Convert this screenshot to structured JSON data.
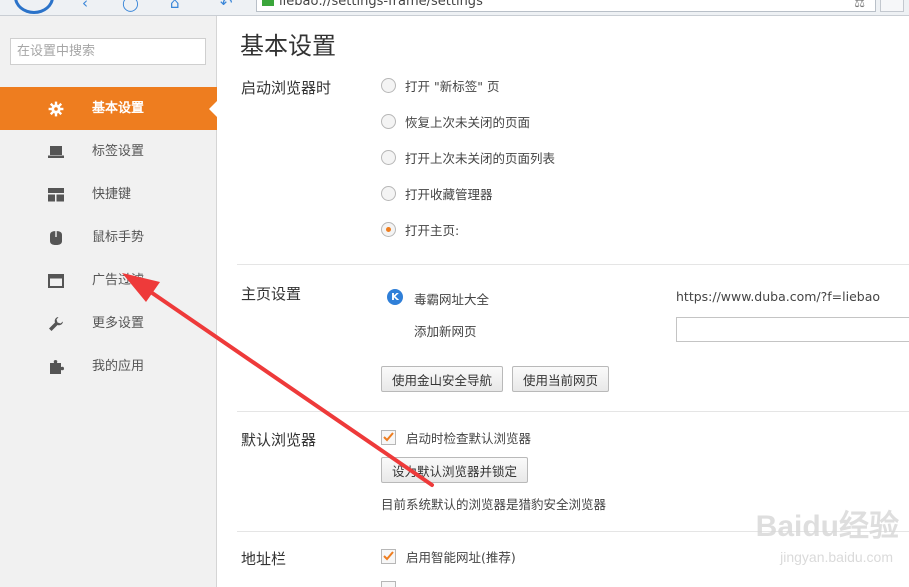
{
  "browser": {
    "address": "liebao://settings-frame/settings"
  },
  "sidebar": {
    "search_placeholder": "在设置中搜索",
    "items": [
      {
        "label": "基本设置",
        "icon": "gear-icon",
        "active": true
      },
      {
        "label": "标签设置",
        "icon": "laptop-icon",
        "active": false
      },
      {
        "label": "快捷键",
        "icon": "layout-icon",
        "active": false
      },
      {
        "label": "鼠标手势",
        "icon": "mouse-icon",
        "active": false
      },
      {
        "label": "广告过滤",
        "icon": "window-icon",
        "active": false
      },
      {
        "label": "更多设置",
        "icon": "wrench-icon",
        "active": false
      },
      {
        "label": "我的应用",
        "icon": "puzzle-icon",
        "active": false
      }
    ]
  },
  "main": {
    "title": "基本设置",
    "startup": {
      "label": "启动浏览器时",
      "options": [
        {
          "label": "打开 \"新标签\" 页",
          "selected": false
        },
        {
          "label": "恢复上次未关闭的页面",
          "selected": false
        },
        {
          "label": "打开上次未关闭的页面列表",
          "selected": false
        },
        {
          "label": "打开收藏管理器",
          "selected": false
        },
        {
          "label": "打开主页:",
          "selected": true
        }
      ]
    },
    "homepage": {
      "label": "主页设置",
      "site_name": "毒霸网址大全",
      "site_url": "https://www.duba.com/?f=liebao",
      "add_label": "添加新网页",
      "btn_kingsoft": "使用金山安全导航",
      "btn_current": "使用当前网页"
    },
    "default_browser": {
      "label": "默认浏览器",
      "check_label": "启动时检查默认浏览器",
      "check_on": true,
      "btn_set": "设为默认浏览器并锁定",
      "status": "目前系统默认的浏览器是猎豹安全浏览器"
    },
    "address_bar": {
      "label": "地址栏",
      "smart_label": "启用智能网址(推荐)",
      "smart_on": true
    }
  },
  "colors": {
    "accent": "#ee7d1f",
    "arrow": "#ee3a3a"
  },
  "watermark": {
    "big": "Baidu经验",
    "small": "jingyan.baidu.com"
  }
}
